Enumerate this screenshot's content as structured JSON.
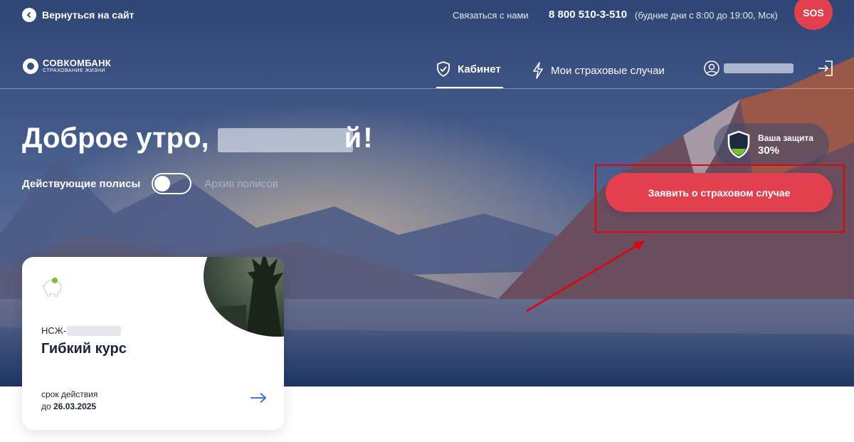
{
  "topbar": {
    "back_label": "Вернуться на сайт",
    "contact_label": "Связаться с нами",
    "phone": "8 800 510-3-510",
    "hours": "(будние дни с 8:00 до 19:00, Мск)",
    "sos_label": "SOS"
  },
  "brand": {
    "name": "СОВКОМБАНК",
    "subtitle": "СТРАХОВАНИЕ ЖИЗНИ"
  },
  "nav": {
    "cabinet": "Кабинет",
    "cases": "Мои страховые случаи"
  },
  "greeting": {
    "text": "Доброе утро,",
    "tail": "й",
    "excl": "!"
  },
  "protection": {
    "label": "Ваша защита",
    "percent": "30%",
    "level": 0.3
  },
  "policies_toggle": {
    "active_label": "Действующие полисы",
    "archive_label": "Архив полисов",
    "archive_on": false
  },
  "cta": {
    "label": "Заявить о страховом случае"
  },
  "policy_card": {
    "number_prefix": "НСЖ-",
    "title": "Гибкий курс",
    "term_label": "срок действия",
    "term_prefix": "до",
    "term_date": "26.03.2025"
  },
  "colors": {
    "accent": "#e2404e",
    "annotation": "#e3000f",
    "link_arrow": "#2f67c8"
  }
}
